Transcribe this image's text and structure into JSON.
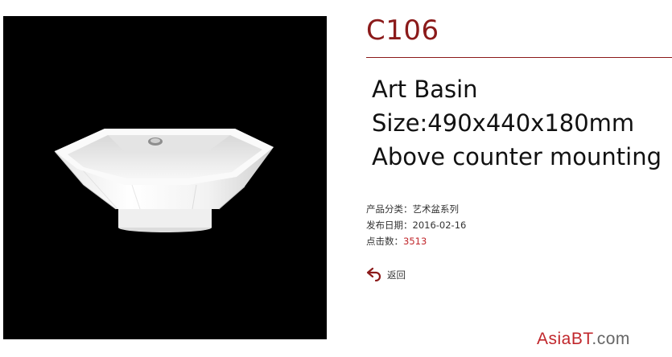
{
  "product": {
    "code": "C106",
    "lines": [
      "Art Basin",
      "Size:490x440x180mm",
      "Above counter mounting"
    ]
  },
  "meta": {
    "category_label": "产品分类：",
    "category_value": "艺术盆系列",
    "date_label": "发布日期：",
    "date_value": "2016-02-16",
    "clicks_label": "点击数：",
    "clicks_value": "3513"
  },
  "back": {
    "label": "返回"
  },
  "watermark": {
    "part1": "Asia",
    "part2": "BT",
    "part3": ".com"
  },
  "colors": {
    "accent": "#8b1a1a",
    "highlight": "#c0262b",
    "image_bg": "#000000"
  },
  "icons": {
    "back": "return-arrow-icon"
  }
}
